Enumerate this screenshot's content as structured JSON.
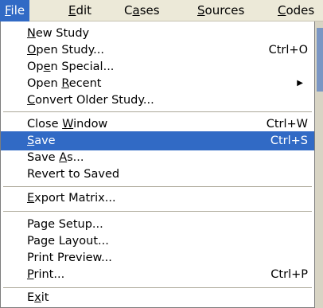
{
  "menubar": {
    "items": [
      {
        "label_pre": "",
        "mnemonic": "F",
        "label_post": "ile"
      },
      {
        "label_pre": "",
        "mnemonic": "E",
        "label_post": "dit"
      },
      {
        "label_pre": "C",
        "mnemonic": "a",
        "label_post": "ses"
      },
      {
        "label_pre": "",
        "mnemonic": "S",
        "label_post": "ources"
      },
      {
        "label_pre": "",
        "mnemonic": "C",
        "label_post": "odes"
      }
    ]
  },
  "file_menu": {
    "items": [
      {
        "pre": "",
        "mn": "N",
        "post": "ew Study",
        "shortcut": ""
      },
      {
        "pre": "",
        "mn": "O",
        "post": "pen Study...",
        "shortcut": "Ctrl+O"
      },
      {
        "pre": "Op",
        "mn": "e",
        "post": "n Special...",
        "shortcut": ""
      },
      {
        "pre": "Open ",
        "mn": "R",
        "post": "ecent",
        "shortcut": "",
        "submenu_arrow": "▶"
      },
      {
        "pre": "",
        "mn": "C",
        "post": "onvert Older Study...",
        "shortcut": ""
      },
      {
        "pre": "Close ",
        "mn": "W",
        "post": "indow",
        "shortcut": "Ctrl+W"
      },
      {
        "pre": "",
        "mn": "S",
        "post": "ave",
        "shortcut": "Ctrl+S",
        "highlighted": true
      },
      {
        "pre": "Save ",
        "mn": "A",
        "post": "s...",
        "shortcut": ""
      },
      {
        "pre": "Revert to Saved",
        "mn": "",
        "post": "",
        "shortcut": ""
      },
      {
        "pre": "",
        "mn": "E",
        "post": "xport Matrix...",
        "shortcut": ""
      },
      {
        "pre": "Page Setup...",
        "mn": "",
        "post": "",
        "shortcut": ""
      },
      {
        "pre": "Page Layout...",
        "mn": "",
        "post": "",
        "shortcut": ""
      },
      {
        "pre": "Print Preview...",
        "mn": "",
        "post": "",
        "shortcut": ""
      },
      {
        "pre": "",
        "mn": "P",
        "post": "rint...",
        "shortcut": "Ctrl+P"
      },
      {
        "pre": "E",
        "mn": "x",
        "post": "it",
        "shortcut": ""
      }
    ]
  },
  "colors": {
    "highlight": "#316ac5",
    "menubar_bg": "#ece9d8",
    "separator": "#aca899"
  }
}
